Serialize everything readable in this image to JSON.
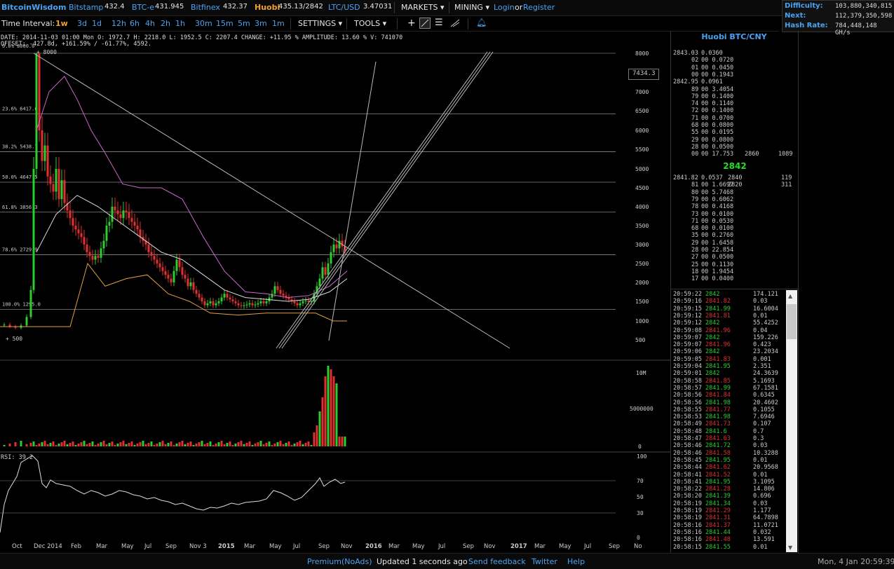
{
  "topbar": {
    "brand": "BitcoinWisdom",
    "markets": [
      {
        "name": "Bitstamp",
        "price": "432.4"
      },
      {
        "name": "BTC-e",
        "price": "431.945"
      },
      {
        "name": "Bitfinex",
        "price": "432.37"
      },
      {
        "name": "Huobi",
        "price": "435.13/2842"
      },
      {
        "name": "LTC/USD",
        "price": "3.47031"
      }
    ],
    "markets_menu": "MARKETS",
    "mining_menu": "MINING",
    "login": "Login",
    "or": "or",
    "register": "Register"
  },
  "stats": {
    "difficulty_label": "Difficulty:",
    "difficulty": "103,880,340,815",
    "next_label": "Next:",
    "next": "112,379,350,598",
    "hashrate_label": "Hash Rate:",
    "hashrate": "784,448,148 GH/s"
  },
  "intervals": {
    "label": "Time Interval:",
    "items": [
      "1w",
      "3d",
      "1d",
      "12h",
      "6h",
      "4h",
      "2h",
      "1h",
      "30m",
      "15m",
      "5m",
      "3m",
      "1m"
    ],
    "active": "1w",
    "settings": "SETTINGS",
    "tools": "TOOLS"
  },
  "info": {
    "line": "DATE: 2014-11-03 01:00 Mon    O: 1972.7    H: 2218.0    L: 1952.5    C: 2207.4    CHANGE: +11.95 %    AMPLITUDE: 13.60 %    V: 741070",
    "offset": "OFFSET: -427.8d, +161.59% / -61.77%, 4592.",
    "top_fib": "0.0% 8000.0",
    "top_mark": "+ 8000",
    "bottom_mark": "+ 500",
    "price_box": "7434.3",
    "rsi_label": "RSI: 39.2"
  },
  "chart_data": {
    "type": "candlestick",
    "y_axis_ticks": [
      "8000",
      "7000",
      "6500",
      "6000",
      "5500",
      "5000",
      "4500",
      "4000",
      "3500",
      "3000",
      "2500",
      "2000",
      "1500",
      "1000",
      "500"
    ],
    "fib_levels": [
      {
        "label": "23.6% 6417.6",
        "value": 6417.6
      },
      {
        "label": "38.2% 5438.7",
        "value": 5438.7
      },
      {
        "label": "50.0% 4647.5",
        "value": 4647.5
      },
      {
        "label": "61.8% 3856.3",
        "value": 3856.3
      },
      {
        "label": "78.6% 2729.9",
        "value": 2729.9
      },
      {
        "label": "100.0% 1295.0",
        "value": 1295.0
      }
    ],
    "volume_ticks": [
      "10M",
      "5000000",
      "0"
    ],
    "rsi_ticks": [
      "100",
      "70",
      "50",
      "30",
      "0"
    ],
    "x_labels": [
      "Oct",
      "Dec 2014",
      "Feb",
      "Mar",
      "May",
      "Jul",
      "Sep",
      "Nov 3",
      "2015",
      "Mar",
      "May",
      "Jul",
      "Sep",
      "Nov",
      "2016",
      "Mar",
      "May",
      "Jul",
      "Sep",
      "Nov",
      "2017",
      "Mar",
      "May",
      "Jul",
      "Sep",
      "No",
      "Now"
    ]
  },
  "book": {
    "title": "Huobi BTC/CNY",
    "asks": [
      [
        "2843.03",
        "00",
        "0.0360"
      ],
      [
        "",
        "02",
        "00 0.0720"
      ],
      [
        "",
        "01",
        "00 0.0450"
      ],
      [
        "",
        "00",
        "00 0.1943"
      ],
      [
        "2842.95",
        "00",
        "0.0961"
      ],
      [
        "",
        "89",
        "00 3.4054"
      ],
      [
        "",
        "79",
        "00 0.1400"
      ],
      [
        "",
        "74",
        "00 0.1140"
      ],
      [
        "",
        "72",
        "00 0.1400"
      ],
      [
        "",
        "71",
        "00 0.0700"
      ],
      [
        "",
        "68",
        "00 0.0800"
      ],
      [
        "",
        "55",
        "00 0.0195"
      ],
      [
        "",
        "29",
        "00 0.0800"
      ],
      [
        "",
        "28",
        "00 0.0500"
      ],
      [
        "",
        "00",
        "00 17.753"
      ]
    ],
    "ask_side_label": "2860",
    "ask_side_vol": "1089",
    "mid": "2842",
    "bids": [
      [
        "2841.82",
        "00",
        "0.0537"
      ],
      [
        "",
        "81",
        "00 1.6697"
      ],
      [
        "",
        "80",
        "00 5.7468"
      ],
      [
        "",
        "79",
        "00 0.6062"
      ],
      [
        "",
        "78",
        "00 0.4168"
      ],
      [
        "",
        "73",
        "00 0.0100"
      ],
      [
        "",
        "71",
        "00 0.0530"
      ],
      [
        "",
        "68",
        "00 0.0100"
      ],
      [
        "",
        "35",
        "00 0.2760"
      ],
      [
        "",
        "29",
        "00 1.6458"
      ],
      [
        "",
        "28",
        "00 22.854"
      ],
      [
        "",
        "27",
        "00 0.0500"
      ],
      [
        "",
        "25",
        "00 0.1130"
      ],
      [
        "",
        "18",
        "00 1.9454"
      ],
      [
        "",
        "17",
        "00 0.0400"
      ]
    ],
    "bid_side": [
      [
        "2840",
        "119"
      ],
      [
        "2820",
        "311"
      ]
    ]
  },
  "trades": [
    [
      "20:59:22",
      "2842",
      "174.121",
      "g"
    ],
    [
      "20:59:16",
      "2841.82",
      "0.03",
      "r"
    ],
    [
      "20:59:15",
      "2841.99",
      "16.6004",
      "g"
    ],
    [
      "20:59:12",
      "2841.81",
      "0.01",
      "r"
    ],
    [
      "20:59:12",
      "2842",
      "55.4252",
      "g"
    ],
    [
      "20:59:08",
      "2841.96",
      "0.04",
      "r"
    ],
    [
      "20:59:07",
      "2842",
      "159.226",
      "g"
    ],
    [
      "20:59:07",
      "2841.96",
      "0.423",
      "r"
    ],
    [
      "20:59:06",
      "2842",
      "23.2034",
      "g"
    ],
    [
      "20:59:05",
      "2841.83",
      "0.001",
      "r"
    ],
    [
      "20:59:04",
      "2841.95",
      "2.351",
      "g"
    ],
    [
      "20:59:01",
      "2842",
      "24.3639",
      "g"
    ],
    [
      "20:58:58",
      "2841.85",
      "5.1693",
      "r"
    ],
    [
      "20:58:57",
      "2841.99",
      "67.1581",
      "g"
    ],
    [
      "20:58:56",
      "2841.84",
      "0.6345",
      "r"
    ],
    [
      "20:58:56",
      "2841.98",
      "20.4602",
      "g"
    ],
    [
      "20:58:55",
      "2841.77",
      "0.1055",
      "r"
    ],
    [
      "20:58:53",
      "2841.98",
      "7.6946",
      "g"
    ],
    [
      "20:58:49",
      "2841.73",
      "0.107",
      "r"
    ],
    [
      "20:58:48",
      "2841.6",
      "0.7",
      "g"
    ],
    [
      "20:58:47",
      "2841.63",
      "0.3",
      "r"
    ],
    [
      "20:58:46",
      "2841.72",
      "0.03",
      "g"
    ],
    [
      "20:58:46",
      "2841.58",
      "10.3288",
      "r"
    ],
    [
      "20:58:45",
      "2841.95",
      "0.01",
      "g"
    ],
    [
      "20:58:44",
      "2841.62",
      "20.9568",
      "r"
    ],
    [
      "20:58:41",
      "2841.52",
      "0.01",
      "r"
    ],
    [
      "20:58:41",
      "2841.95",
      "3.1095",
      "g"
    ],
    [
      "20:58:22",
      "2841.28",
      "14.806",
      "r"
    ],
    [
      "20:58:20",
      "2841.39",
      "0.696",
      "g"
    ],
    [
      "20:58:19",
      "2841.34",
      "0.03",
      "g"
    ],
    [
      "20:58:19",
      "2841.29",
      "1.177",
      "r"
    ],
    [
      "20:58:19",
      "2841.31",
      "64.7898",
      "r"
    ],
    [
      "20:58:16",
      "2841.37",
      "11.0721",
      "r"
    ],
    [
      "20:58:16",
      "2841.44",
      "0.032",
      "g"
    ],
    [
      "20:58:16",
      "2841.48",
      "13.591",
      "r"
    ],
    [
      "20:58:15",
      "2841.55",
      "0.01",
      "g"
    ]
  ],
  "bottom": {
    "premium": "Premium(NoAds)",
    "updated": "Updated 1 seconds ago",
    "feedback": "Send feedback",
    "twitter": "Twitter",
    "help": "Help",
    "clock": "Mon, 4 Jan 20:59:39"
  },
  "colors": {
    "up": "#2ecc2e",
    "down": "#e03030",
    "accent": "#4aa3f2",
    "huobi": "#f0a030"
  }
}
